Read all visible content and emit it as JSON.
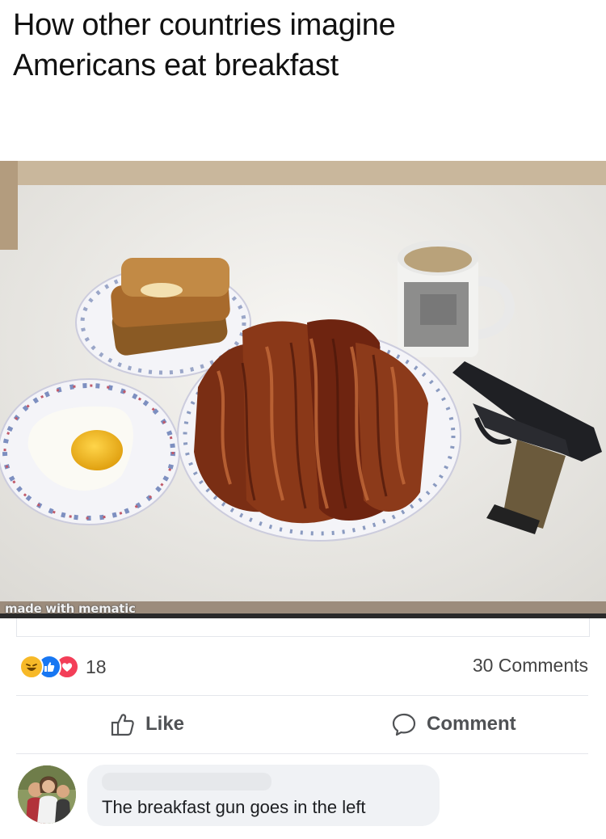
{
  "caption": {
    "line1": "How other countries imagine",
    "line2": "Americans eat breakfast"
  },
  "photo": {
    "watermark": "made with mematic"
  },
  "reactions": {
    "icons": [
      "haha-icon",
      "like-icon",
      "love-icon"
    ],
    "count": "18"
  },
  "comments_count": "30 Comments",
  "actions": {
    "like_label": "Like",
    "comment_label": "Comment"
  },
  "comment": {
    "text": "The breakfast gun goes in the left"
  },
  "colors": {
    "like_blue": "#1877f2",
    "love_red": "#f33e58",
    "haha_yellow": "#f7b928",
    "bubble_bg": "#f0f2f5"
  }
}
